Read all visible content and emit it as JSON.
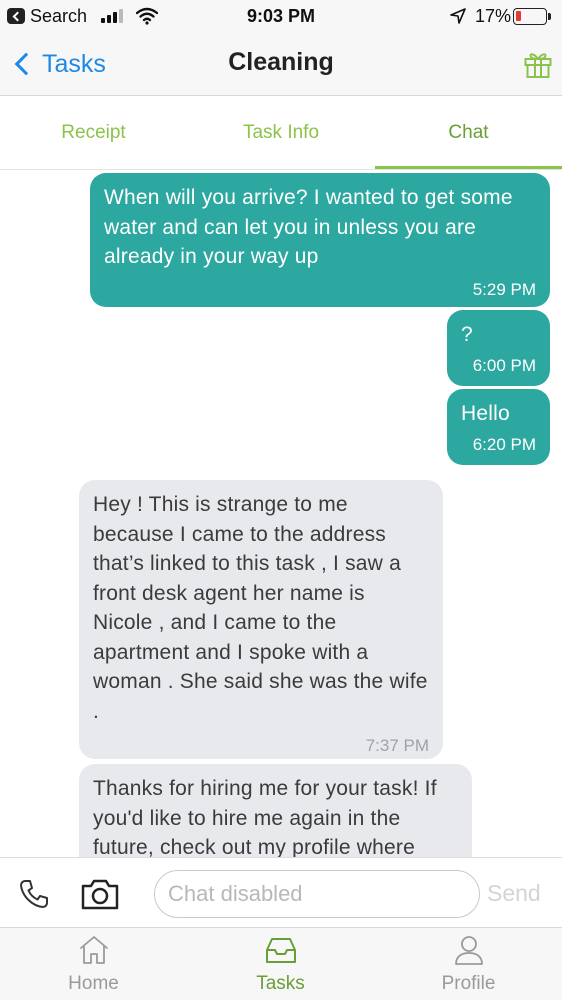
{
  "status_bar": {
    "back_app": "Search",
    "time": "9:03 PM",
    "battery_percent": "17%",
    "battery_level": 0.17,
    "signal_bars": 3,
    "signal_total": 4
  },
  "nav": {
    "back_label": "Tasks",
    "title": "Cleaning",
    "right_icon": "gift-icon"
  },
  "tabs": [
    {
      "label": "Receipt",
      "active": false
    },
    {
      "label": "Task Info",
      "active": false
    },
    {
      "label": "Chat",
      "active": true
    }
  ],
  "messages": [
    {
      "direction": "outgoing",
      "text": "When will you arrive? I wanted to get some water and can let you in unless you are already in your way up",
      "time": "5:29 PM"
    },
    {
      "direction": "outgoing",
      "text": "?",
      "time": "6:00 PM"
    },
    {
      "direction": "outgoing",
      "text": "Hello",
      "time": "6:20 PM"
    },
    {
      "direction": "incoming",
      "text": "Hey ! This is strange to me because I came to the address that’s linked to this task , I saw a front desk agent her name is Nicole , and I came to the apartment and I spoke with a woman . She said she was the wife .",
      "time": "7:37 PM"
    },
    {
      "direction": "incoming",
      "text": "Thanks for hiring me for your task! If you'd like to hire me again in the future, check out my profile where",
      "time": ""
    }
  ],
  "input_bar": {
    "placeholder": "Chat disabled",
    "send_label": "Send"
  },
  "bottom_tabs": [
    {
      "label": "Home",
      "icon": "home-icon",
      "active": false
    },
    {
      "label": "Tasks",
      "icon": "tasks-tray-icon",
      "active": true
    },
    {
      "label": "Profile",
      "icon": "profile-icon",
      "active": false
    }
  ],
  "colors": {
    "outgoing_bubble": "#2ca8a0",
    "incoming_bubble": "#e8e9ed",
    "accent_green": "#8bc34a",
    "link_blue": "#1e88e5",
    "battery_low": "#e53935"
  }
}
